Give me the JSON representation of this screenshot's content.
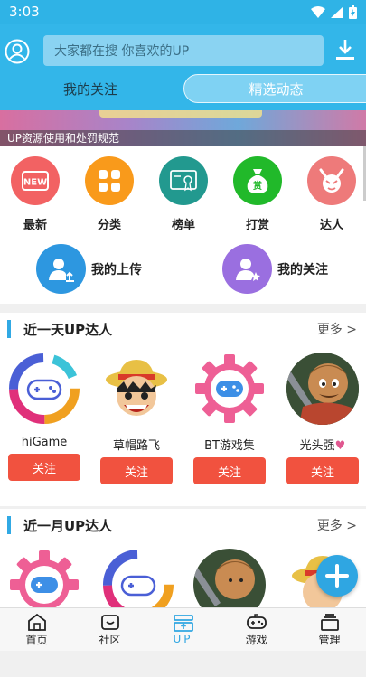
{
  "status": {
    "time": "3:03"
  },
  "search": {
    "placeholder": "大家都在搜  你喜欢的UP"
  },
  "tabs": {
    "following": "我的关注",
    "featured": "精选动态"
  },
  "banner": {
    "caption": "UP资源使用和处罚规范"
  },
  "quick_actions": [
    {
      "label": "最新",
      "icon": "new-icon",
      "color": "#f26263"
    },
    {
      "label": "分类",
      "icon": "grid-icon",
      "color": "#f99a1b"
    },
    {
      "label": "榜单",
      "icon": "certificate-icon",
      "color": "#22998f"
    },
    {
      "label": "打赏",
      "icon": "money-bag-icon",
      "color": "#21b92a"
    },
    {
      "label": "达人",
      "icon": "devil-icon",
      "color": "#ee7a7a"
    }
  ],
  "big_actions": [
    {
      "label": "我的上传",
      "icon": "upload-user-icon",
      "color": "#2d97e0"
    },
    {
      "label": "我的关注",
      "icon": "star-user-icon",
      "color": "#9a6fe0"
    }
  ],
  "sections": [
    {
      "title": "近一天UP达人",
      "more": "更多 >",
      "users": [
        {
          "name": "hiGame",
          "follow": "关注",
          "avatar": "gamepad-ring-avatar"
        },
        {
          "name": "草帽路飞",
          "follow": "关注",
          "avatar": "luffy-avatar"
        },
        {
          "name": "BT游戏集",
          "follow": "关注",
          "avatar": "gamepad-gear-avatar"
        },
        {
          "name": "光头强",
          "follow": "关注",
          "avatar": "bald-qiang-avatar"
        }
      ]
    },
    {
      "title": "近一月UP达人",
      "more": "更多 >",
      "users": [
        {
          "avatar": "gamepad-gear-avatar"
        },
        {
          "avatar": "gamepad-ring-avatar"
        },
        {
          "avatar": "bald-qiang-avatar"
        },
        {
          "avatar": "luffy-avatar"
        }
      ]
    }
  ],
  "nav": [
    {
      "label": "首页",
      "icon": "home-icon"
    },
    {
      "label": "社区",
      "icon": "community-icon"
    },
    {
      "label": "UP",
      "icon": "up-icon",
      "active": true
    },
    {
      "label": "游戏",
      "icon": "gamepad-icon"
    },
    {
      "label": "管理",
      "icon": "manage-icon"
    }
  ],
  "colors": {
    "primary": "#33b6e9",
    "follow": "#f1523f",
    "accent_bar": "#31a9e4"
  }
}
